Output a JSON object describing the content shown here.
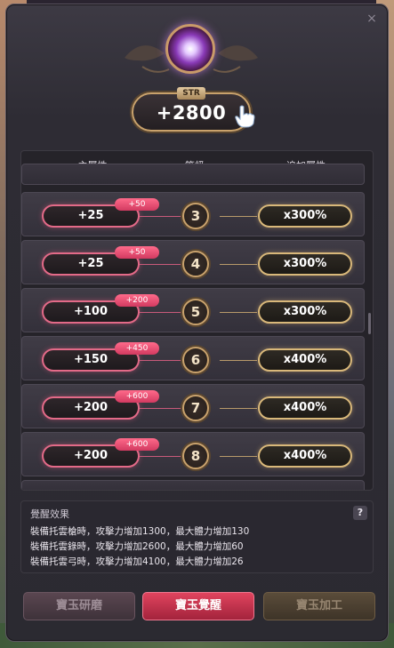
{
  "window": {
    "close_glyph": "×"
  },
  "stat": {
    "tag": "STR",
    "value": "+2800"
  },
  "table": {
    "headers": {
      "main": "主屬性",
      "level": "等級",
      "bonus": "追加屬性"
    },
    "rows": [
      {
        "main": "+25",
        "badge": "+50",
        "level": "3",
        "bonus": "x300%"
      },
      {
        "main": "+25",
        "badge": "+50",
        "level": "4",
        "bonus": "x300%"
      },
      {
        "main": "+100",
        "badge": "+200",
        "level": "5",
        "bonus": "x300%"
      },
      {
        "main": "+150",
        "badge": "+450",
        "level": "6",
        "bonus": "x400%"
      },
      {
        "main": "+200",
        "badge": "+600",
        "level": "7",
        "bonus": "x400%"
      },
      {
        "main": "+200",
        "badge": "+600",
        "level": "8",
        "bonus": "x400%"
      }
    ]
  },
  "effects": {
    "title": "覺醒效果",
    "help": "?",
    "lines": [
      "裝備托雲槍時，攻擊力增加1300，最大體力增加130",
      "裝備托雲錄時，攻擊力增加2600，最大體力增加60",
      "裝備托雲弓時，攻擊力增加4100，最大體力增加26"
    ]
  },
  "buttons": {
    "polish": "寶玉研磨",
    "awaken": "寶玉覺醒",
    "process": "寶玉加工"
  },
  "colors": {
    "accent_pink": "#e36a88",
    "accent_gold": "#d9b87a",
    "primary_button": "#d23a52"
  }
}
